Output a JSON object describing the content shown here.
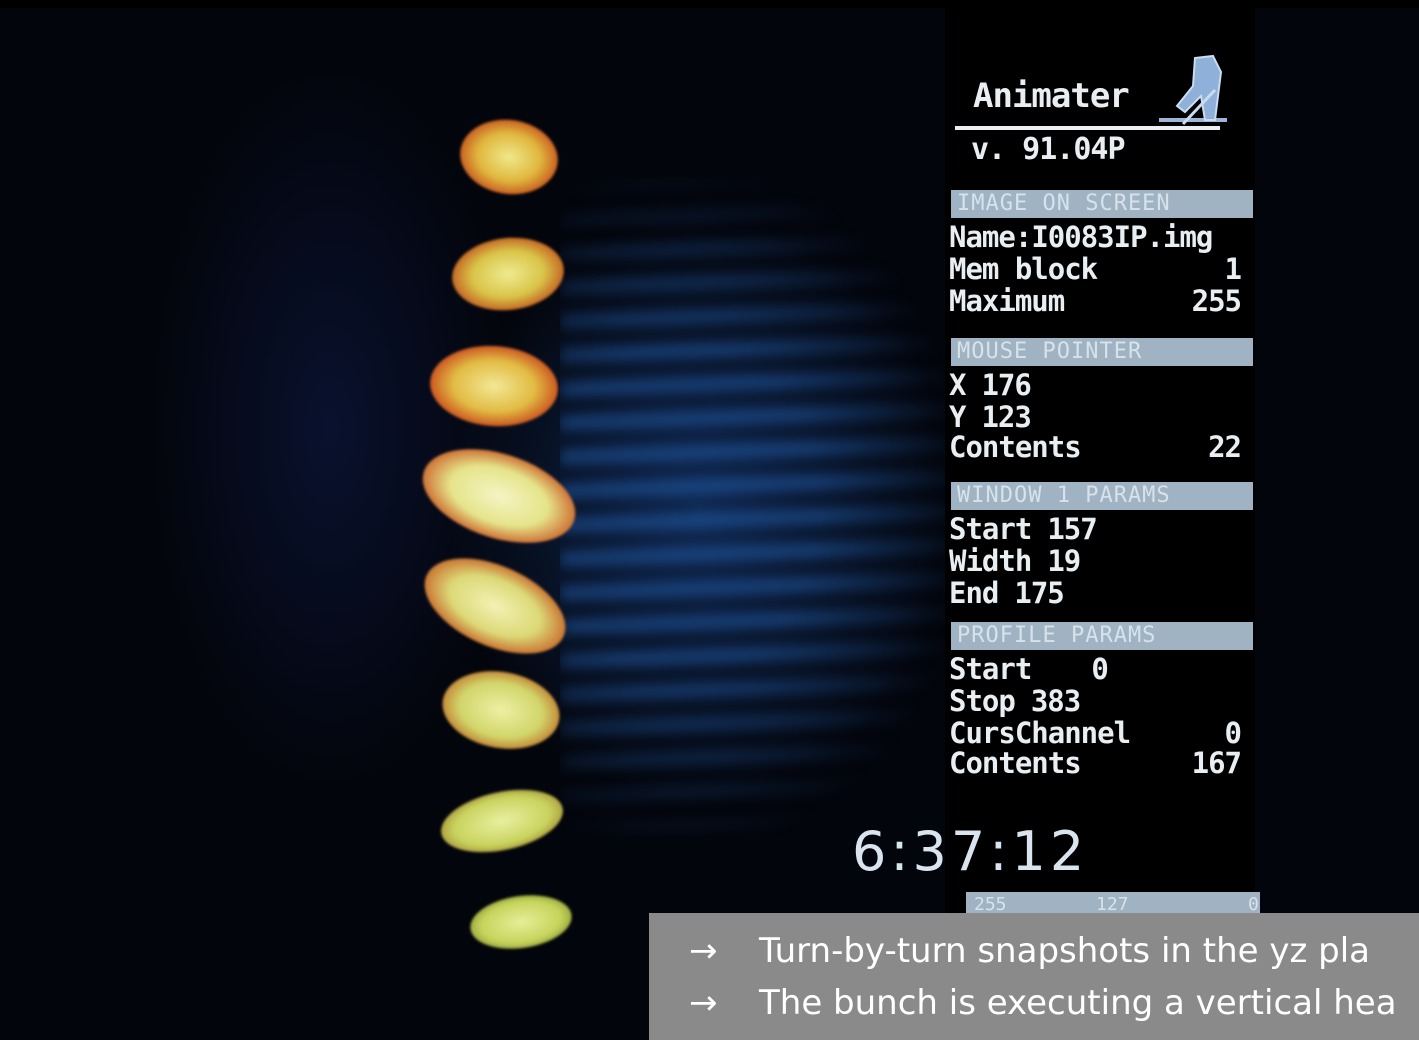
{
  "app": {
    "title": "Animater",
    "version": "v. 91.04P",
    "icon": "skier-icon"
  },
  "sections": [
    {
      "header": "IMAGE ON SCREEN",
      "rows": [
        {
          "label": "Name:",
          "value": "I0083IP.img"
        },
        {
          "label": "Mem block",
          "value": "1"
        },
        {
          "label": "Maximum",
          "value": "255"
        }
      ]
    },
    {
      "header": "MOUSE POINTER",
      "rows": [
        {
          "label": "X",
          "value": "176"
        },
        {
          "label": "Y",
          "value": "123"
        },
        {
          "label": "Contents",
          "value": "22"
        }
      ]
    },
    {
      "header": "WINDOW 1 PARAMS",
      "rows": [
        {
          "label": "Start",
          "value": "157"
        },
        {
          "label": "Width",
          "value": "19"
        },
        {
          "label": "End",
          "value": "175"
        }
      ]
    },
    {
      "header": "PROFILE PARAMS",
      "rows": [
        {
          "label": "Start",
          "value": "0"
        },
        {
          "label": "Stop",
          "value": "383"
        },
        {
          "label": "CursChannel",
          "value": "0"
        },
        {
          "label": "Contents",
          "value": "167"
        }
      ]
    }
  ],
  "clock": "6:37:12",
  "status_bar": {
    "left": "255",
    "middle": "127",
    "right": "0"
  },
  "caption": {
    "lines": [
      "Turn-by-turn snapshots in the yz pla",
      "The bunch is executing a vertical hea"
    ],
    "bullet": "→"
  },
  "colors": {
    "panel_header": "#9fb3c2",
    "caption_bg": "#8a8a8a",
    "bunch_core": "#e8f27a",
    "bunch_edge": "#e0431c"
  }
}
